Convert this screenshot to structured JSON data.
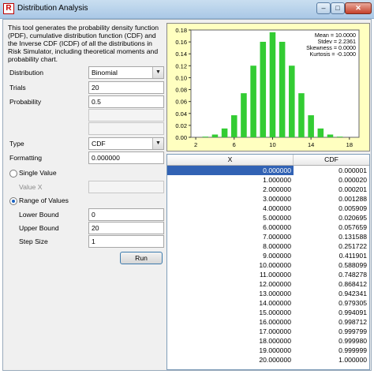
{
  "window": {
    "title": "Distribution Analysis",
    "min": "–",
    "max": "□",
    "close": "✕"
  },
  "description": "This tool generates the probability density function (PDF), cumulative distribution function (CDF) and the Inverse CDF (ICDF) of all the distributions in Risk Simulator, including theoretical moments and probability chart.",
  "form": {
    "distribution_label": "Distribution",
    "distribution_value": "Binomial",
    "trials_label": "Trials",
    "trials_value": "20",
    "probability_label": "Probability",
    "probability_value": "0.5",
    "type_label": "Type",
    "type_value": "CDF",
    "formatting_label": "Formatting",
    "formatting_value": "0.000000",
    "single_value_label": "Single Value",
    "value_x_label": "Value X",
    "range_label": "Range of Values",
    "lower_label": "Lower Bound",
    "lower_value": "0",
    "upper_label": "Upper Bound",
    "upper_value": "20",
    "step_label": "Step Size",
    "step_value": "1",
    "run_label": "Run",
    "selected_mode": "range"
  },
  "chart_data": {
    "type": "bar",
    "x": [
      0,
      1,
      2,
      3,
      4,
      5,
      6,
      7,
      8,
      9,
      10,
      11,
      12,
      13,
      14,
      15,
      16,
      17,
      18,
      19,
      20
    ],
    "values": [
      1e-06,
      1.9e-05,
      0.000181,
      0.001087,
      0.004621,
      0.014786,
      0.036964,
      0.073929,
      0.120134,
      0.160179,
      0.176197,
      0.160179,
      0.120134,
      0.073929,
      0.036964,
      0.014786,
      0.004621,
      0.001087,
      0.000181,
      1.9e-05,
      1e-06
    ],
    "ylim": [
      0,
      0.18
    ],
    "y_ticks": [
      "0.00",
      "0.02",
      "0.04",
      "0.06",
      "0.08",
      "0.10",
      "0.12",
      "0.14",
      "0.16",
      "0.18"
    ],
    "x_ticks": [
      "2",
      "6",
      "10",
      "14",
      "18"
    ],
    "bar_color": "#33cc33",
    "stats": [
      "Mean = 10.0000",
      "Stdev = 2.2361",
      "Skewness = 0.0000",
      "Kurtosis = -0.1000"
    ]
  },
  "table": {
    "headers": [
      "X",
      "CDF"
    ],
    "rows": [
      [
        "0.000000",
        "0.000001"
      ],
      [
        "1.000000",
        "0.000020"
      ],
      [
        "2.000000",
        "0.000201"
      ],
      [
        "3.000000",
        "0.001288"
      ],
      [
        "4.000000",
        "0.005909"
      ],
      [
        "5.000000",
        "0.020695"
      ],
      [
        "6.000000",
        "0.057659"
      ],
      [
        "7.000000",
        "0.131588"
      ],
      [
        "8.000000",
        "0.251722"
      ],
      [
        "9.000000",
        "0.411901"
      ],
      [
        "10.000000",
        "0.588099"
      ],
      [
        "11.000000",
        "0.748278"
      ],
      [
        "12.000000",
        "0.868412"
      ],
      [
        "13.000000",
        "0.942341"
      ],
      [
        "14.000000",
        "0.979305"
      ],
      [
        "15.000000",
        "0.994091"
      ],
      [
        "16.000000",
        "0.998712"
      ],
      [
        "17.000000",
        "0.999799"
      ],
      [
        "18.000000",
        "0.999980"
      ],
      [
        "19.000000",
        "0.999999"
      ],
      [
        "20.000000",
        "1.000000"
      ]
    ]
  }
}
